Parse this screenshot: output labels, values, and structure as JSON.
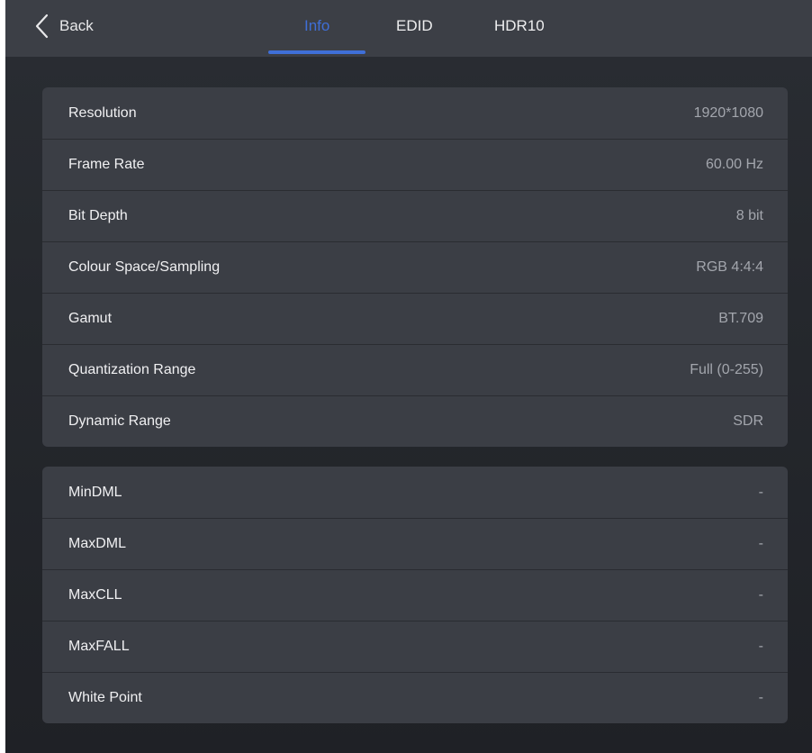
{
  "header": {
    "back_label": "Back",
    "tabs": [
      {
        "label": "Info",
        "active": true
      },
      {
        "label": "EDID",
        "active": false
      },
      {
        "label": "HDR10",
        "active": false
      }
    ]
  },
  "video_info": [
    {
      "label": "Resolution",
      "value": "1920*1080"
    },
    {
      "label": "Frame Rate",
      "value": "60.00 Hz"
    },
    {
      "label": "Bit Depth",
      "value": "8 bit"
    },
    {
      "label": "Colour Space/Sampling",
      "value": "RGB 4:4:4"
    },
    {
      "label": "Gamut",
      "value": "BT.709"
    },
    {
      "label": "Quantization Range",
      "value": "Full (0-255)"
    },
    {
      "label": "Dynamic Range",
      "value": "SDR"
    }
  ],
  "hdr_info": [
    {
      "label": "MinDML",
      "value": "-"
    },
    {
      "label": "MaxDML",
      "value": "-"
    },
    {
      "label": "MaxCLL",
      "value": "-"
    },
    {
      "label": "MaxFALL",
      "value": "-"
    },
    {
      "label": "White Point",
      "value": "-"
    }
  ],
  "colors": {
    "accent": "#3f6fd8",
    "topbar": "#3c3f46",
    "card": "#3b3e45",
    "value_text": "#a3a6ad"
  }
}
